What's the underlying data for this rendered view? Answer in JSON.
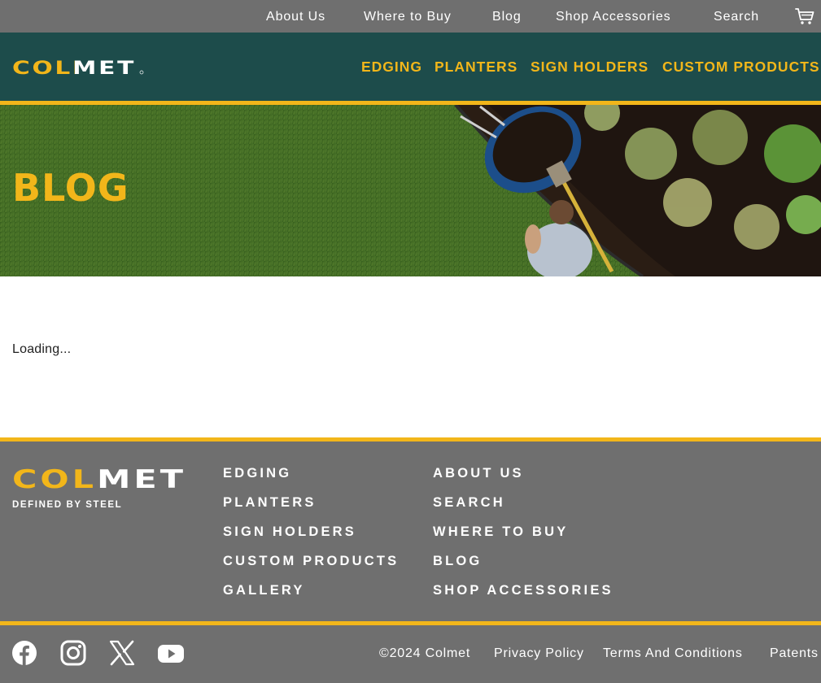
{
  "top_nav": {
    "items": [
      {
        "label": "About Us"
      },
      {
        "label": "Where to Buy"
      },
      {
        "label": "Blog"
      },
      {
        "label": "Shop Accessories"
      },
      {
        "label": "Search"
      }
    ],
    "cart_icon": "cart-icon"
  },
  "header": {
    "logo_text": "COLMET",
    "nav": [
      {
        "label": "EDGING"
      },
      {
        "label": "PLANTERS"
      },
      {
        "label": "SIGN HOLDERS"
      },
      {
        "label": "CUSTOM PRODUCTS"
      }
    ]
  },
  "hero": {
    "title": "BLOG"
  },
  "content": {
    "status": "Loading..."
  },
  "footer": {
    "logo_text": "COLMET",
    "tagline": "DEFINED BY STEEL",
    "col1": [
      {
        "label": "EDGING"
      },
      {
        "label": "PLANTERS"
      },
      {
        "label": "SIGN HOLDERS"
      },
      {
        "label": "CUSTOM PRODUCTS"
      },
      {
        "label": "GALLERY"
      }
    ],
    "col2": [
      {
        "label": "ABOUT US"
      },
      {
        "label": "SEARCH"
      },
      {
        "label": "WHERE TO BUY"
      },
      {
        "label": "BLOG"
      },
      {
        "label": "SHOP ACCESSORIES"
      }
    ],
    "social": [
      "facebook-icon",
      "instagram-icon",
      "x-icon",
      "youtube-icon"
    ],
    "copyright": "©2024 Colmet",
    "legal": [
      {
        "label": "Privacy Policy"
      },
      {
        "label": "Terms And Conditions"
      },
      {
        "label": "Patents"
      }
    ]
  },
  "colors": {
    "utility_bar": "#6f6f6f",
    "header_bg": "#1d4c4b",
    "accent": "#f2b61a",
    "footer_bg": "#6f6f6f"
  }
}
